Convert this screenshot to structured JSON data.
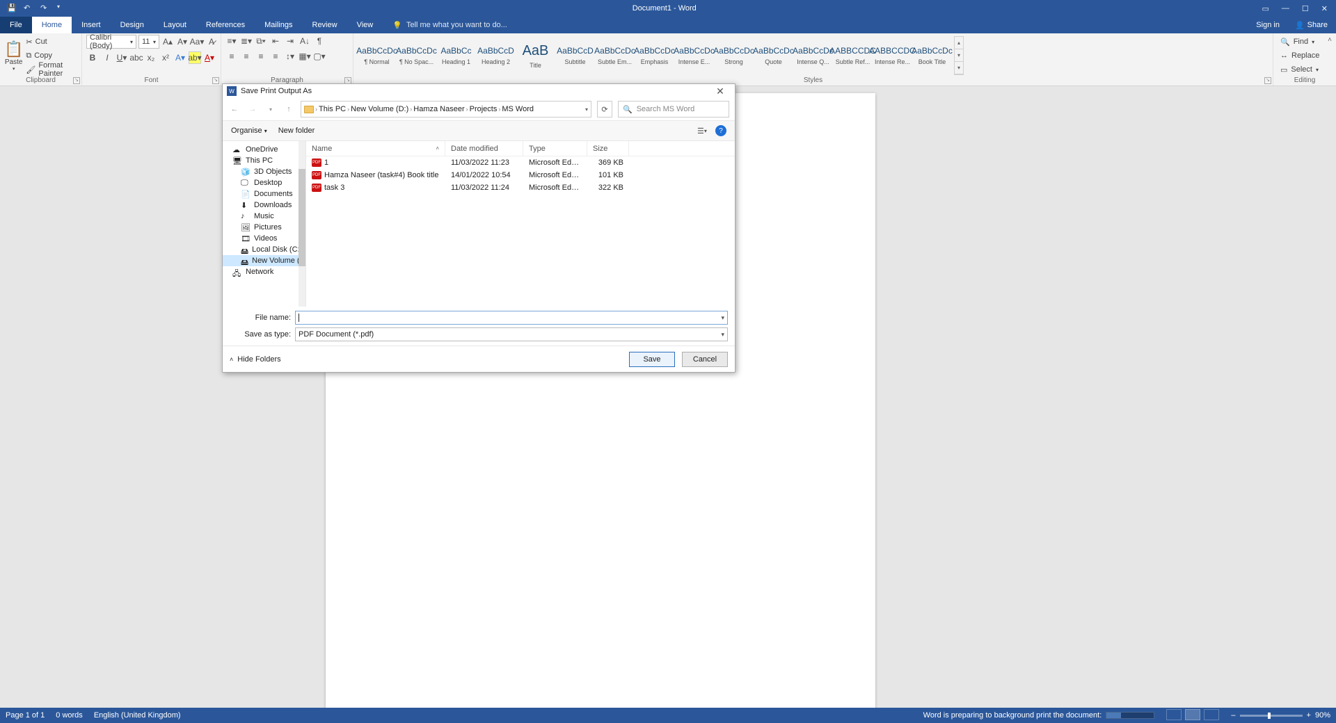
{
  "titlebar": {
    "title": "Document1 - Word"
  },
  "tabs": {
    "file": "File",
    "items": [
      "Home",
      "Insert",
      "Design",
      "Layout",
      "References",
      "Mailings",
      "Review",
      "View"
    ],
    "active": "Home",
    "tellme": "Tell me what you want to do...",
    "signin": "Sign in",
    "share": "Share"
  },
  "ribbon": {
    "clipboard": {
      "paste": "Paste",
      "cut": "Cut",
      "copy": "Copy",
      "format_painter": "Format Painter",
      "label": "Clipboard"
    },
    "font": {
      "name": "Calibri (Body)",
      "size": "11",
      "label": "Font"
    },
    "paragraph": {
      "label": "Paragraph"
    },
    "styles": {
      "label": "Styles",
      "items": [
        {
          "preview": "AaBbCcDc",
          "name": "¶ Normal"
        },
        {
          "preview": "AaBbCcDc",
          "name": "¶ No Spac..."
        },
        {
          "preview": "AaBbCc",
          "name": "Heading 1"
        },
        {
          "preview": "AaBbCcD",
          "name": "Heading 2"
        },
        {
          "preview": "AaB",
          "name": "Title",
          "title": true
        },
        {
          "preview": "AaBbCcD",
          "name": "Subtitle"
        },
        {
          "preview": "AaBbCcDc",
          "name": "Subtle Em..."
        },
        {
          "preview": "AaBbCcDc",
          "name": "Emphasis"
        },
        {
          "preview": "AaBbCcDc",
          "name": "Intense E..."
        },
        {
          "preview": "AaBbCcDc",
          "name": "Strong"
        },
        {
          "preview": "AaBbCcDc",
          "name": "Quote"
        },
        {
          "preview": "AaBbCcDc",
          "name": "Intense Q..."
        },
        {
          "preview": "AABBCCDC",
          "name": "Subtle Ref..."
        },
        {
          "preview": "AABBCCDC",
          "name": "Intense Re..."
        },
        {
          "preview": "AaBbCcDc",
          "name": "Book Title"
        }
      ]
    },
    "editing": {
      "find": "Find",
      "replace": "Replace",
      "select": "Select",
      "label": "Editing"
    }
  },
  "dialog": {
    "title": "Save Print Output As",
    "breadcrumb": [
      "This PC",
      "New Volume (D:)",
      "Hamza Naseer",
      "Projects",
      "MS Word"
    ],
    "search_placeholder": "Search MS Word",
    "organise": "Organise",
    "newfolder": "New folder",
    "tree": [
      {
        "label": "OneDrive",
        "icon": "cloud",
        "lv": 1
      },
      {
        "label": "This PC",
        "icon": "pc",
        "lv": 1
      },
      {
        "label": "3D Objects",
        "icon": "3d",
        "lv": 2
      },
      {
        "label": "Desktop",
        "icon": "desktop",
        "lv": 2
      },
      {
        "label": "Documents",
        "icon": "docs",
        "lv": 2
      },
      {
        "label": "Downloads",
        "icon": "down",
        "lv": 2
      },
      {
        "label": "Music",
        "icon": "music",
        "lv": 2
      },
      {
        "label": "Pictures",
        "icon": "pics",
        "lv": 2
      },
      {
        "label": "Videos",
        "icon": "video",
        "lv": 2
      },
      {
        "label": "Local Disk (C:)",
        "icon": "disk",
        "lv": 2
      },
      {
        "label": "New Volume (D:)",
        "icon": "disk",
        "lv": 2,
        "sel": true
      },
      {
        "label": "Network",
        "icon": "net",
        "lv": 1
      }
    ],
    "columns": {
      "name": "Name",
      "date": "Date modified",
      "type": "Type",
      "size": "Size"
    },
    "files": [
      {
        "name": "1",
        "date": "11/03/2022 11:23",
        "type": "Microsoft Edge P...",
        "size": "369 KB"
      },
      {
        "name": "Hamza Naseer (task#4) Book title",
        "date": "14/01/2022 10:54",
        "type": "Microsoft Edge P...",
        "size": "101 KB"
      },
      {
        "name": "task 3",
        "date": "11/03/2022 11:24",
        "type": "Microsoft Edge P...",
        "size": "322 KB"
      }
    ],
    "filename_label": "File name:",
    "filename_value": "",
    "saveas_label": "Save as type:",
    "saveas_value": "PDF Document (*.pdf)",
    "hide_folders": "Hide Folders",
    "save": "Save",
    "cancel": "Cancel"
  },
  "status": {
    "page": "Page 1 of 1",
    "words": "0 words",
    "lang": "English (United Kingdom)",
    "bgprint": "Word is preparing to background print the document:",
    "zoom": "90%"
  }
}
